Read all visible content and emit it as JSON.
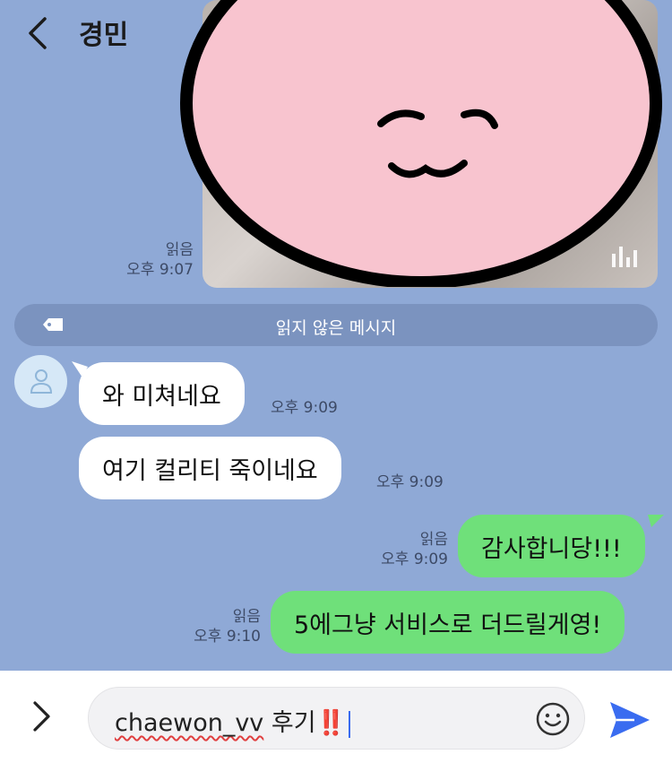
{
  "header": {
    "title": "경민"
  },
  "messages": [
    {
      "id": "m0",
      "side": "out",
      "type": "media",
      "read": "읽음",
      "time": "오후 9:07"
    },
    {
      "id": "m1",
      "side": "in",
      "text": "와 미쳐네요",
      "time": "오후 9:09"
    },
    {
      "id": "m2",
      "side": "in",
      "text": "여기 컬리티 죽이네요",
      "time": "오후 9:09"
    },
    {
      "id": "m3",
      "side": "out",
      "text": "감사합니당!!!",
      "read": "읽음",
      "time": "오후 9:09"
    },
    {
      "id": "m4",
      "side": "out",
      "text": "5에그냥 서비스로 더드릴게영!",
      "read": "읽음",
      "time": "오후 9:10"
    }
  ],
  "unread_divider": "읽지 않은 메시지",
  "composer": {
    "text_user": "chaewon_vv",
    "text_rest": " 후기",
    "text_marks": "‼️"
  },
  "colors": {
    "background": "#8fa9d6",
    "incoming_bubble": "#ffffff",
    "outgoing_bubble": "#6fe07a",
    "send": "#3a6cf0"
  },
  "icons": [
    "back-icon",
    "stats-icon",
    "tag-icon",
    "avatar-icon",
    "expand-icon",
    "emoji-icon",
    "send-icon"
  ]
}
